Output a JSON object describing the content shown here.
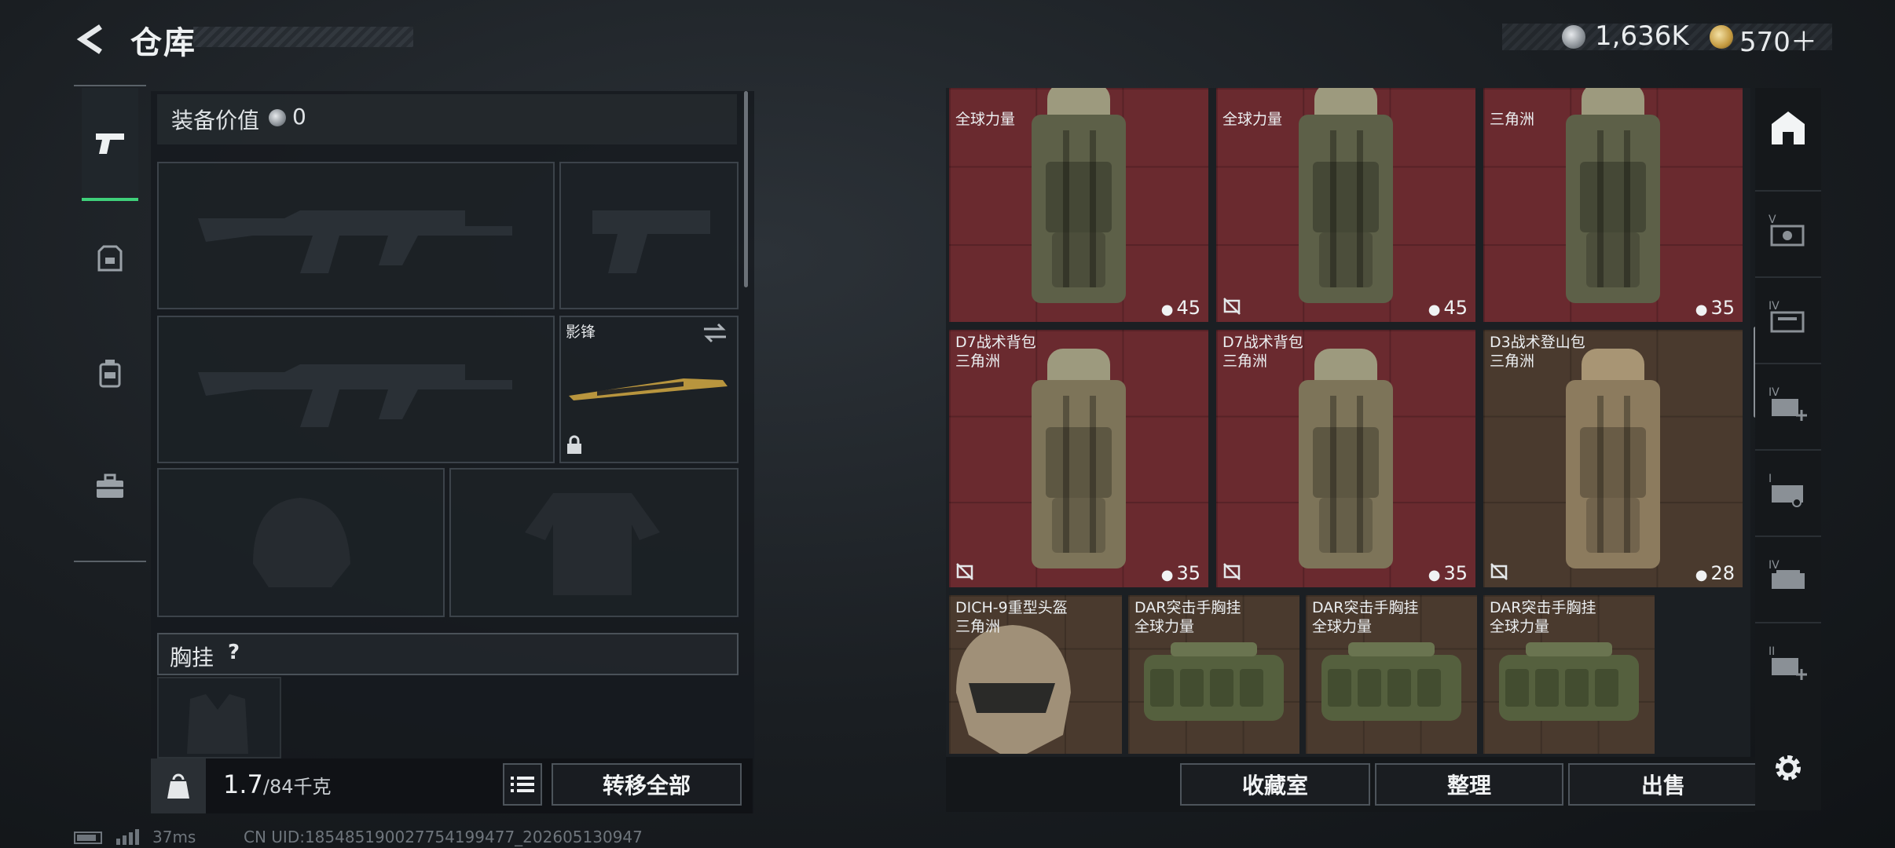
{
  "header": {
    "title": "仓库",
    "currency_silver": "1,636K",
    "currency_gold": "570＋"
  },
  "tabs": [
    {
      "icon": "pistol-icon",
      "active": true
    },
    {
      "icon": "armor-icon",
      "active": false
    },
    {
      "icon": "backpack-icon",
      "active": false
    },
    {
      "icon": "toolbox-icon",
      "active": false
    }
  ],
  "equipment": {
    "value_label": "装备价值",
    "value": "0",
    "melee_name": "影锋",
    "vest_label": "胸挂",
    "vest_help": "?",
    "weight_value": "1.7",
    "weight_max": "/84千克",
    "transfer_all": "转移全部"
  },
  "inventory": {
    "items": [
      {
        "name": "",
        "sub": "全球力量",
        "count": "45",
        "bg": "red",
        "kind": "backpack-green",
        "flag": false
      },
      {
        "name": "",
        "sub": "全球力量",
        "count": "45",
        "bg": "red",
        "kind": "backpack-green",
        "flag": true
      },
      {
        "name": "",
        "sub": "三角洲",
        "count": "35",
        "bg": "red",
        "kind": "backpack-green",
        "flag": false
      },
      {
        "name": "D7战术背包",
        "sub": "三角洲",
        "count": "35",
        "bg": "red",
        "kind": "backpack-tan",
        "flag": true
      },
      {
        "name": "D7战术背包",
        "sub": "三角洲",
        "count": "35",
        "bg": "red",
        "kind": "backpack-tan",
        "flag": true
      },
      {
        "name": "D3战术登山包",
        "sub": "三角洲",
        "count": "28",
        "bg": "tan",
        "kind": "backpack-camo",
        "flag": true
      },
      {
        "name": "DICH-9重型头盔",
        "sub": "三角洲",
        "count": "",
        "bg": "tan",
        "kind": "helmet",
        "flag": false
      },
      {
        "name": "DAR突击手胸挂",
        "sub": "全球力量",
        "count": "",
        "bg": "tan",
        "kind": "vest",
        "flag": false
      },
      {
        "name": "DAR突击手胸挂",
        "sub": "全球力量",
        "count": "",
        "bg": "tan",
        "kind": "vest",
        "flag": false
      },
      {
        "name": "DAR突击手胸挂",
        "sub": "全球力量",
        "count": "",
        "bg": "tan",
        "kind": "vest",
        "flag": false
      }
    ],
    "buttons": {
      "collection": "收藏室",
      "sort": "整理",
      "sell": "出售"
    }
  },
  "right_sidebar": [
    {
      "icon": "safehouse-icon"
    },
    {
      "icon": "tier-v-container-icon",
      "tier": "V"
    },
    {
      "icon": "tier-iv-container-icon",
      "tier": "IV"
    },
    {
      "icon": "tier-iv-add-icon",
      "tier": "IV"
    },
    {
      "icon": "tier-i-container-icon",
      "tier": "I"
    },
    {
      "icon": "tier-iv-box-icon",
      "tier": "IV"
    },
    {
      "icon": "tier-ii-add-icon",
      "tier": "II"
    }
  ],
  "status": {
    "ping": "37ms",
    "uid": "CN UID:1854851900277541994​77_202605130947"
  },
  "colors": {
    "accent_green": "#3fd07a",
    "item_red": "#6a2a2f",
    "item_tan": "#4a3a2e"
  }
}
